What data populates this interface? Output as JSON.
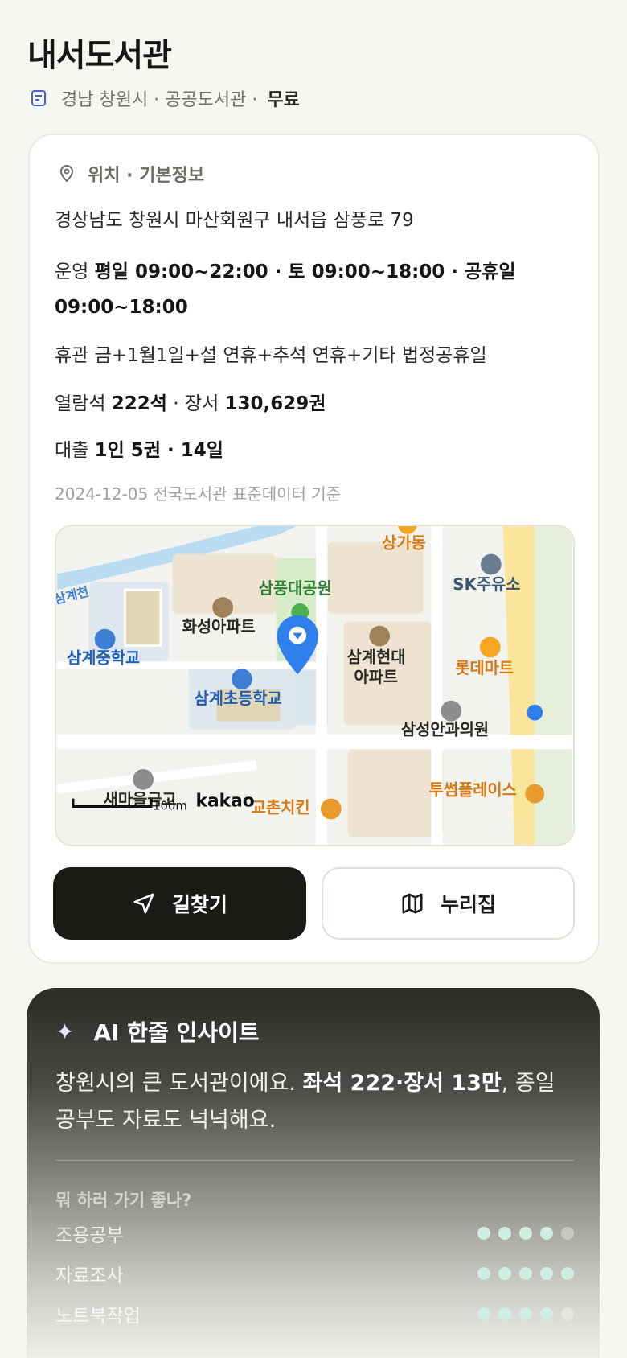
{
  "header": {
    "title": "내서도서관",
    "meta_text": "경남 창원시 · 공공도서관 ·",
    "fee": "무료"
  },
  "info": {
    "section_title": "위치 · 기본정보",
    "address": "경상남도 창원시 마산회원구 내서읍 삼풍로 79",
    "hours_label": "운영",
    "hours_value": "평일 09:00~22:00 · 토 09:00~18:00 · 공휴일 09:00~18:00",
    "closed": "휴관 금+1월1일+설 연휴+추석 연휴+기타 법정공휴일",
    "seats_label": "열람석",
    "seats_value": "222석",
    "books_label": "· 장서",
    "books_value": "130,629권",
    "loan_label": "대출",
    "loan_value": "1인 5권 · 14일",
    "source": "2024-12-05 전국도서관 표준데이터 기준"
  },
  "map": {
    "labels": {
      "sangga": "상가동",
      "sk": "SK주유소",
      "samgyecheon": "삼계천",
      "park": "삼풍대공원",
      "hwaseong": "화성아파트",
      "middle_school": "삼계중학교",
      "hyundai_1": "삼계현대",
      "hyundai_2": "아파트",
      "lotte": "롯데마트",
      "elementary": "삼계초등학교",
      "eye_clinic": "삼성안과의원",
      "saemaeul": "새마을금고",
      "scale": "100m",
      "kakao": "kakao",
      "kyochon": "교촌치킨",
      "twosome": "투썸플레이스"
    }
  },
  "buttons": {
    "directions": "길찾기",
    "nurijip": "누리집"
  },
  "ai": {
    "title": "AI 한줄 인사이트",
    "text_pre": "창원시의 큰 도서관이에요. ",
    "text_bold": "좌석 222·장서 13만",
    "text_post": ", 종일 공부도 자료도 넉넉해요.",
    "question": "뭐 하러 가기 좋나?",
    "ratings": [
      {
        "label": "조용공부",
        "score": 4,
        "max": 5
      },
      {
        "label": "자료조사",
        "score": 5,
        "max": 5
      },
      {
        "label": "노트북작업",
        "score": 4,
        "max": 5
      }
    ]
  },
  "colors": {
    "primary_dark": "#1b1a17",
    "rating_dot": "#cfeee1",
    "map_pin": "#2f80ed"
  }
}
